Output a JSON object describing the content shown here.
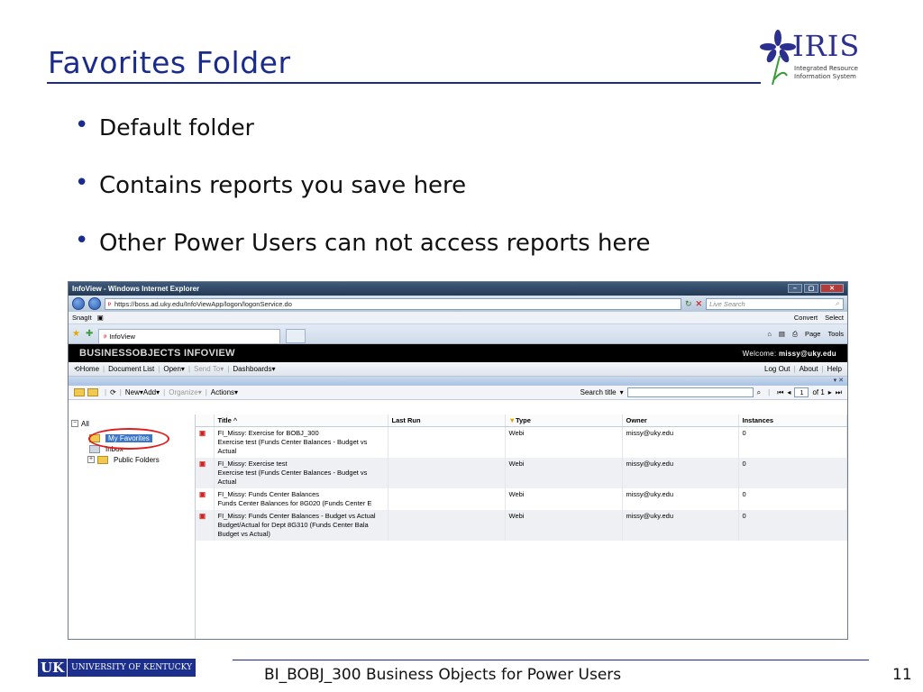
{
  "slide": {
    "title": "Favorites Folder",
    "bullets": [
      "Default folder",
      "Contains reports you save here",
      "Other Power Users can not access reports here"
    ],
    "logo": {
      "word": "IRIS",
      "sub_line1": "Integrated Resource",
      "sub_line2": "Information System"
    },
    "footer": {
      "uk_short": "UK",
      "university": "UNIVERSITY OF KENTUCKY",
      "course": "BI_BOBJ_300 Business Objects for Power Users",
      "page": "11"
    },
    "colors": {
      "title": "#1a2b8c",
      "accent_rule": "#1a2b8c",
      "highlight_circle": "#e01b1b"
    }
  },
  "browser": {
    "window_title": "InfoView - Windows Internet Explorer",
    "address": "https://boss.ad.uky.edu/InfoViewApp/logon/logonService.do",
    "live_search_placeholder": "Live Search",
    "snagit": "SnagIt",
    "convert": "Convert",
    "select": "Select",
    "tab_label": "InfoView",
    "page_menu": "Page",
    "tools_menu": "Tools"
  },
  "bo": {
    "brand": "BUSINESSOBJECTS INFOVIEW",
    "welcome_label": "Welcome:",
    "welcome_user": "missy@uky.edu",
    "toolbar": {
      "home": "Home",
      "document_list": "Document List",
      "open": "Open",
      "send_to": "Send To",
      "dashboards": "Dashboards",
      "log_out": "Log Out",
      "about": "About",
      "help": "Help"
    },
    "actionbar": {
      "new": "New",
      "add": "Add",
      "organize": "Organize",
      "actions": "Actions",
      "search_title": "Search title",
      "page_current": "1",
      "page_of": "of 1"
    },
    "tree": {
      "all": "All",
      "my_favorites": "My Favorites",
      "inbox": "Inbox",
      "public_folders": "Public Folders"
    },
    "columns": {
      "title": "Title",
      "last_run": "Last Run",
      "type": "Type",
      "owner": "Owner",
      "instances": "Instances"
    },
    "rows": [
      {
        "title": "FI_Missy: Exercise for BOBJ_300",
        "desc": "Exercise test (Funds Center Balances - Budget vs Actual",
        "type": "Webi",
        "owner": "missy@uky.edu",
        "instances": "0"
      },
      {
        "title": "FI_Missy: Exercise test",
        "desc": "Exercise test (Funds Center Balances - Budget vs Actual",
        "type": "Webi",
        "owner": "missy@uky.edu",
        "instances": "0"
      },
      {
        "title": "FI_Missy: Funds Center Balances",
        "desc": "Funds Center Balances for 8G020 (Funds Center E",
        "type": "Webi",
        "owner": "missy@uky.edu",
        "instances": "0"
      },
      {
        "title": "FI_Missy: Funds Center Balances - Budget vs Actual",
        "desc": "Budget/Actual for Dept 8G310 (Funds Center Bala Budget vs Actual)",
        "type": "Webi",
        "owner": "missy@uky.edu",
        "instances": "0"
      }
    ]
  }
}
